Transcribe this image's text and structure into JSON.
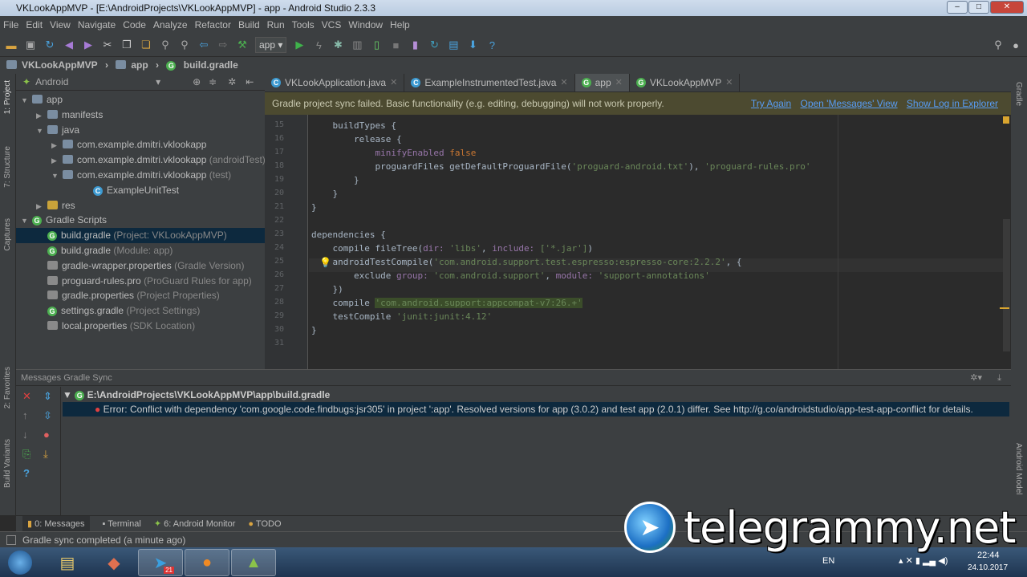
{
  "window": {
    "title": "VKLookAppMVP - [E:\\AndroidProjects\\VKLookAppMVP] - app - Android Studio 2.3.3",
    "min": "–",
    "max": "□",
    "close": "✕"
  },
  "menu": [
    "File",
    "Edit",
    "View",
    "Navigate",
    "Code",
    "Analyze",
    "Refactor",
    "Build",
    "Run",
    "Tools",
    "VCS",
    "Window",
    "Help"
  ],
  "toolbar": {
    "run_config": "app ▾"
  },
  "breadcrumb": [
    "VKLookAppMVP",
    "app",
    "build.gradle"
  ],
  "left_stripe": [
    "1: Project",
    "7: Structure",
    "Captures",
    "2: Favorites",
    "Build Variants"
  ],
  "right_stripe": [
    "Gradle",
    "Android Model"
  ],
  "project": {
    "view": "Android",
    "tree": [
      {
        "label": "app",
        "hint": "",
        "indent": 0,
        "arrow": "▼",
        "icon": "folder",
        "color": "#7a8da1"
      },
      {
        "label": "manifests",
        "hint": "",
        "indent": 1,
        "arrow": "▶",
        "icon": "folder",
        "color": "#7a8da1"
      },
      {
        "label": "java",
        "hint": "",
        "indent": 1,
        "arrow": "▼",
        "icon": "folder",
        "color": "#7a8da1"
      },
      {
        "label": "com.example.dmitri.vklookapp",
        "hint": "",
        "indent": 2,
        "arrow": "▶",
        "icon": "package",
        "color": "#7a8da1"
      },
      {
        "label": "com.example.dmitri.vklookapp",
        "hint": "(androidTest)",
        "indent": 2,
        "arrow": "▶",
        "icon": "package",
        "color": "#7a8da1"
      },
      {
        "label": "com.example.dmitri.vklookapp",
        "hint": "(test)",
        "indent": 2,
        "arrow": "▼",
        "icon": "package",
        "color": "#7a8da1"
      },
      {
        "label": "ExampleUnitTest",
        "hint": "",
        "indent": 4,
        "arrow": "",
        "icon": "class",
        "color": "#3d9ad1"
      },
      {
        "label": "res",
        "hint": "",
        "indent": 1,
        "arrow": "▶",
        "icon": "folder",
        "color": "#c9a33a"
      },
      {
        "label": "Gradle Scripts",
        "hint": "",
        "indent": 0,
        "arrow": "▼",
        "icon": "gradle",
        "color": "#4caf50"
      },
      {
        "label": "build.gradle",
        "hint": "(Project: VKLookAppMVP)",
        "indent": 1,
        "arrow": "",
        "icon": "gradle",
        "color": "#4caf50",
        "selected": true
      },
      {
        "label": "build.gradle",
        "hint": "(Module: app)",
        "indent": 1,
        "arrow": "",
        "icon": "gradle",
        "color": "#4caf50"
      },
      {
        "label": "gradle-wrapper.properties",
        "hint": "(Gradle Version)",
        "indent": 1,
        "arrow": "",
        "icon": "props",
        "color": "#8a8a8a"
      },
      {
        "label": "proguard-rules.pro",
        "hint": "(ProGuard Rules for app)",
        "indent": 1,
        "arrow": "",
        "icon": "file",
        "color": "#8a8a8a"
      },
      {
        "label": "gradle.properties",
        "hint": "(Project Properties)",
        "indent": 1,
        "arrow": "",
        "icon": "props",
        "color": "#8a8a8a"
      },
      {
        "label": "settings.gradle",
        "hint": "(Project Settings)",
        "indent": 1,
        "arrow": "",
        "icon": "gradle",
        "color": "#4caf50"
      },
      {
        "label": "local.properties",
        "hint": "(SDK Location)",
        "indent": 1,
        "arrow": "",
        "icon": "props",
        "color": "#8a8a8a"
      }
    ]
  },
  "tabs": [
    {
      "label": "VKLookApplication.java",
      "active": false
    },
    {
      "label": "ExampleInstrumentedTest.java",
      "active": false
    },
    {
      "label": "app",
      "active": true
    },
    {
      "label": "VKLookAppMVP",
      "active": false
    }
  ],
  "notice": {
    "text": "Gradle project sync failed. Basic functionality (e.g. editing, debugging) will not work properly.",
    "links": [
      "Try Again",
      "Open 'Messages' View",
      "Show Log in Explorer"
    ]
  },
  "code": [
    {
      "n": "15",
      "t": [
        [
          "    buildTypes {",
          "k"
        ]
      ]
    },
    {
      "n": "16",
      "t": [
        [
          "        release {",
          "k"
        ]
      ]
    },
    {
      "n": "17",
      "t": [
        [
          "            ",
          ""
        ],
        [
          "minifyEnabled ",
          "n"
        ],
        [
          "false",
          "b"
        ]
      ]
    },
    {
      "n": "18",
      "t": [
        [
          "            proguardFiles getDefaultProguardFile(",
          "k"
        ],
        [
          "'proguard-android.txt'",
          "s"
        ],
        [
          "), ",
          "k"
        ],
        [
          "'proguard-rules.pro'",
          "s"
        ]
      ]
    },
    {
      "n": "19",
      "t": [
        [
          "        }",
          "k"
        ]
      ]
    },
    {
      "n": "20",
      "t": [
        [
          "    }",
          "k"
        ]
      ]
    },
    {
      "n": "21",
      "t": [
        [
          "}",
          "k"
        ]
      ]
    },
    {
      "n": "22",
      "t": []
    },
    {
      "n": "23",
      "t": [
        [
          "dependencies {",
          "k"
        ]
      ]
    },
    {
      "n": "24",
      "t": [
        [
          "    compile fileTree(",
          "k"
        ],
        [
          "dir: ",
          "n"
        ],
        [
          "'libs'",
          "s"
        ],
        [
          ", ",
          "k"
        ],
        [
          "include: ",
          "n"
        ],
        [
          "['*.jar']",
          "s"
        ],
        [
          ")",
          "k"
        ]
      ]
    },
    {
      "n": "25",
      "t": [
        [
          "    androidTestCompile(",
          "k"
        ],
        [
          "'com.android.support.test.espresso:espresso-core:2.2.2'",
          "s"
        ],
        [
          ", {",
          "k"
        ]
      ]
    },
    {
      "n": "26",
      "t": [
        [
          "        exclude ",
          "k"
        ],
        [
          "group: ",
          "n"
        ],
        [
          "'com.android.support'",
          "s"
        ],
        [
          ", ",
          "k"
        ],
        [
          "module: ",
          "n"
        ],
        [
          "'support-annotations'",
          "s"
        ]
      ]
    },
    {
      "n": "27",
      "t": [
        [
          "    })",
          "k"
        ]
      ]
    },
    {
      "n": "28",
      "t": [
        [
          "    compile ",
          "k"
        ],
        [
          "'com.android.support:appcompat-v7:26.+'",
          "hl"
        ]
      ]
    },
    {
      "n": "29",
      "t": [
        [
          "    testCompile ",
          "k"
        ],
        [
          "'junit:junit:4.12'",
          "s"
        ]
      ]
    },
    {
      "n": "30",
      "t": [
        [
          "}",
          "k"
        ]
      ]
    },
    {
      "n": "31",
      "t": []
    }
  ],
  "messages": {
    "title": "Messages Gradle Sync",
    "file": "E:\\AndroidProjects\\VKLookAppMVP\\app\\build.gradle",
    "error_label": "Error:",
    "error": "Conflict with dependency 'com.google.code.findbugs:jsr305' in project ':app'. Resolved versions for app (3.0.2) and test app (2.0.1) differ. See http://g.co/androidstudio/app-test-app-conflict for details."
  },
  "bottom_tabs": [
    "0: Messages",
    "Terminal",
    "6: Android Monitor",
    "TODO"
  ],
  "status": "Gradle sync completed (a minute ago)",
  "taskbar": {
    "lang": "EN",
    "time": "22:44",
    "date": "24.10.2017",
    "telegram_badge": "21"
  },
  "watermark": "telegrammy.net"
}
